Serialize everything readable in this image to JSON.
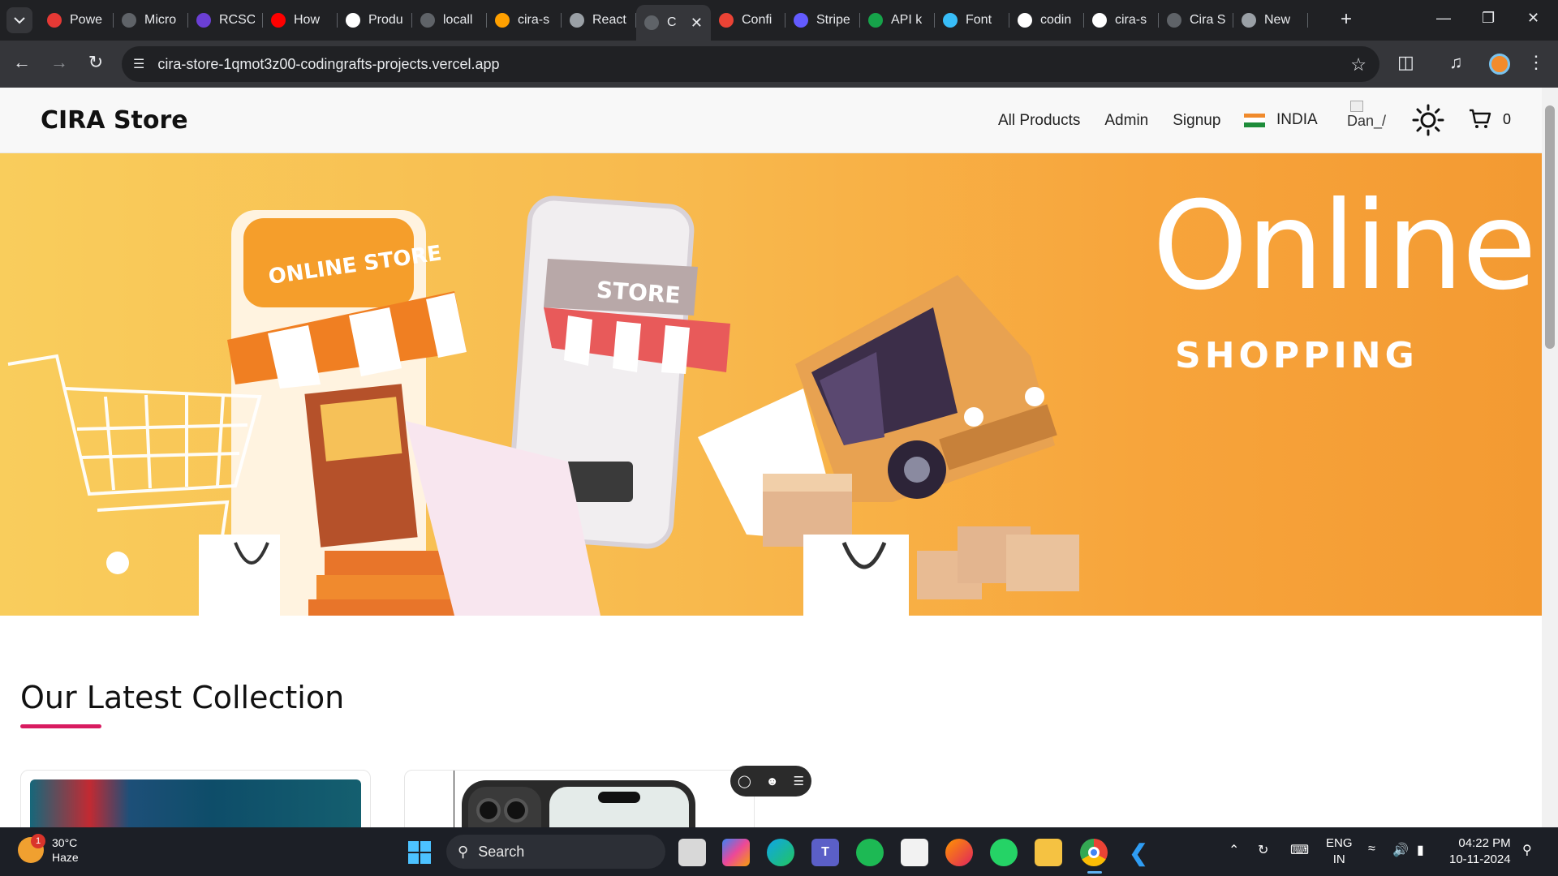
{
  "browser": {
    "tabs": [
      {
        "label": "Powe",
        "icon": "target-icon",
        "color": "#e53935"
      },
      {
        "label": "Micro",
        "icon": "globe-icon",
        "color": "#5f6368"
      },
      {
        "label": "RCSC",
        "icon": "list-icon",
        "color": "#6b3fd4"
      },
      {
        "label": "How",
        "icon": "youtube-icon",
        "color": "#ff0000"
      },
      {
        "label": "Produ",
        "icon": "notion-icon",
        "color": "#ffffff"
      },
      {
        "label": "locall",
        "icon": "globe-icon",
        "color": "#5f6368"
      },
      {
        "label": "cira-s",
        "icon": "firebase-icon",
        "color": "#ffa000"
      },
      {
        "label": "React",
        "icon": "openai-icon",
        "color": "#9aa0a6"
      },
      {
        "label": "C",
        "icon": "globe-icon",
        "color": "#5f6368",
        "active": true
      },
      {
        "label": "Confi",
        "icon": "gmail-icon",
        "color": "#ea4335"
      },
      {
        "label": "Stripe",
        "icon": "stripe-icon",
        "color": "#635bff"
      },
      {
        "label": "API k",
        "icon": "s-icon",
        "color": "#16a34a"
      },
      {
        "label": "Font",
        "icon": "tailwind-icon",
        "color": "#38bdf8"
      },
      {
        "label": "codin",
        "icon": "github-icon",
        "color": "#ffffff"
      },
      {
        "label": "cira-s",
        "icon": "vercel-icon",
        "color": "#ffffff"
      },
      {
        "label": "Cira S",
        "icon": "globe-icon",
        "color": "#5f6368"
      },
      {
        "label": "New",
        "icon": "chrome-icon",
        "color": "#9aa0a6"
      }
    ],
    "url": "cira-store-1qmot3z00-codingrafts-projects.vercel.app"
  },
  "site": {
    "brand": "CIRA Store",
    "nav": {
      "all_products": "All Products",
      "admin": "Admin",
      "signup": "Signup"
    },
    "country": "INDIA",
    "avatar_alt": "Dan_/",
    "cart_count": "0"
  },
  "hero": {
    "headline": "Online.",
    "subheadline": "SHOPPING",
    "store_sign": "ONLINE STORE",
    "phone_sign": "STORE"
  },
  "main": {
    "section_title": "Our Latest Collection"
  },
  "taskbar": {
    "weather_temp": "30°C",
    "weather_desc": "Haze",
    "weather_badge": "1",
    "search_placeholder": "Search",
    "lang_line1": "ENG",
    "lang_line2": "IN",
    "time": "04:22 PM",
    "date": "10-11-2024"
  },
  "colors": {
    "accent_underline": "#d81b60",
    "hero_start": "#f9cd5c",
    "hero_end": "#f39a32"
  }
}
